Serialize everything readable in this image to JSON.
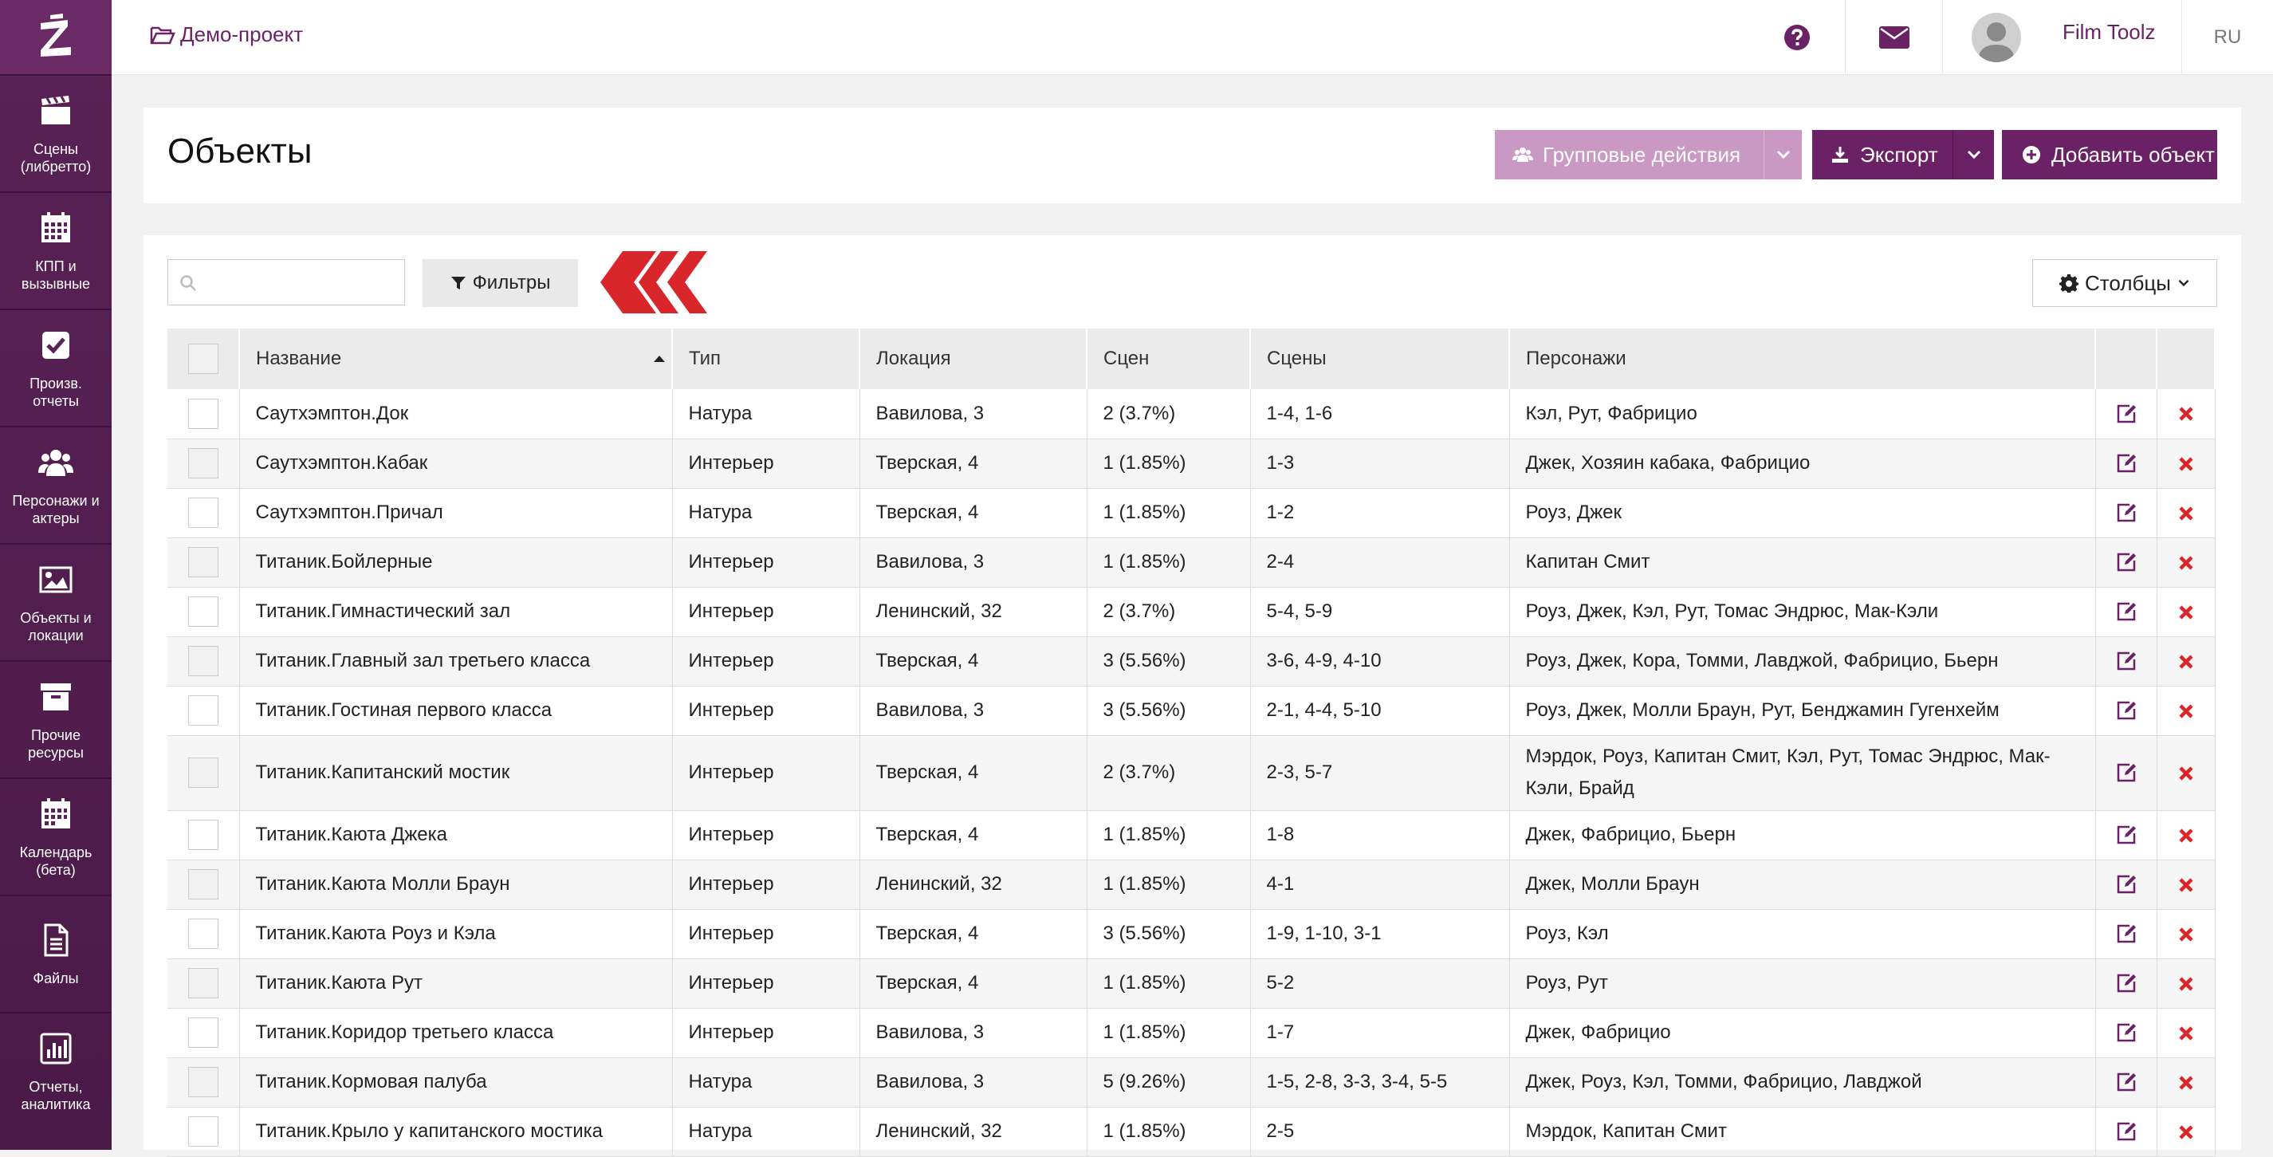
{
  "colors": {
    "sidebar": "#5a2256",
    "accent": "#6a2165",
    "accent_light": "#c998c3",
    "arrow_red": "#d9262a",
    "delete_red": "#d9262a"
  },
  "sidebar": {
    "logo_icon": "z-logo-icon",
    "items": [
      {
        "icon": "clapperboard-icon",
        "label": "Сцены (либретто)"
      },
      {
        "icon": "calendar-grid-icon",
        "label": "КПП и вызывные"
      },
      {
        "icon": "checkbox-icon",
        "label": "Произв. отчеты"
      },
      {
        "icon": "users-icon",
        "label": "Персонажи и актеры"
      },
      {
        "icon": "image-icon",
        "label": "Объекты и локации"
      },
      {
        "icon": "archive-box-icon",
        "label": "Прочие ресурсы"
      },
      {
        "icon": "calendar-icon",
        "label": "Календарь (бета)"
      },
      {
        "icon": "file-icon",
        "label": "Файлы"
      },
      {
        "icon": "bar-chart-icon",
        "label": "Отчеты, аналитика"
      }
    ]
  },
  "topbar": {
    "project": "Демо-проект",
    "user_name": "Film Toolz",
    "language": "RU"
  },
  "header": {
    "title": "Объекты",
    "group_actions_label": "Групповые действия",
    "export_label": "Экспорт",
    "add_label": "Добавить объект"
  },
  "toolbar": {
    "search_placeholder": "",
    "filters_label": "Фильтры",
    "columns_label": "Столбцы"
  },
  "table": {
    "columns": [
      "Название",
      "Тип",
      "Локация",
      "Сцен",
      "Сцены",
      "Персонажи"
    ],
    "rows": [
      [
        "Саутхэмптон.Док",
        "Натура",
        "Вавилова, 3",
        "2 (3.7%)",
        "1-4, 1-6",
        "Кэл, Рут, Фабрицио"
      ],
      [
        "Саутхэмптон.Кабак",
        "Интерьер",
        "Тверская, 4",
        "1 (1.85%)",
        "1-3",
        "Джек, Хозяин кабака, Фабрицио"
      ],
      [
        "Саутхэмптон.Причал",
        "Натура",
        "Тверская, 4",
        "1 (1.85%)",
        "1-2",
        "Роуз, Джек"
      ],
      [
        "Титаник.Бойлерные",
        "Интерьер",
        "Вавилова, 3",
        "1 (1.85%)",
        "2-4",
        "Капитан Смит"
      ],
      [
        "Титаник.Гимнастический зал",
        "Интерьер",
        "Ленинский, 32",
        "2 (3.7%)",
        "5-4, 5-9",
        "Роуз, Джек, Кэл, Рут, Томас Эндрюс, Мак-Кэли"
      ],
      [
        "Титаник.Главный зал третьего класса",
        "Интерьер",
        "Тверская, 4",
        "3 (5.56%)",
        "3-6, 4-9, 4-10",
        "Роуз, Джек, Кора, Томми, Лавджой, Фабрицио, Бьерн"
      ],
      [
        "Титаник.Гостиная первого класса",
        "Интерьер",
        "Вавилова, 3",
        "3 (5.56%)",
        "2-1, 4-4, 5-10",
        "Роуз, Джек, Молли Браун, Рут, Бенджамин Гугенхейм"
      ],
      [
        "Титаник.Капитанский мостик",
        "Интерьер",
        "Тверская, 4",
        "2 (3.7%)",
        "2-3, 5-7",
        "Мэрдок, Роуз, Капитан Смит, Кэл, Рут, Томас Эндрюс, Мак-Кэли, Брайд"
      ],
      [
        "Титаник.Каюта Джека",
        "Интерьер",
        "Тверская, 4",
        "1 (1.85%)",
        "1-8",
        "Джек, Фабрицио, Бьерн"
      ],
      [
        "Титаник.Каюта Молли Браун",
        "Интерьер",
        "Ленинский, 32",
        "1 (1.85%)",
        "4-1",
        "Джек, Молли Браун"
      ],
      [
        "Титаник.Каюта Роуз и Кэла",
        "Интерьер",
        "Тверская, 4",
        "3 (5.56%)",
        "1-9, 1-10, 3-1",
        "Роуз, Кэл"
      ],
      [
        "Титаник.Каюта Рут",
        "Интерьер",
        "Тверская, 4",
        "1 (1.85%)",
        "5-2",
        "Роуз, Рут"
      ],
      [
        "Титаник.Коридор третьего класса",
        "Интерьер",
        "Вавилова, 3",
        "1 (1.85%)",
        "1-7",
        "Джек, Фабрицио"
      ],
      [
        "Титаник.Кормовая палуба",
        "Натура",
        "Вавилова, 3",
        "5 (9.26%)",
        "1-5, 2-8, 3-3, 3-4, 5-5",
        "Джек, Роуз, Кэл, Томми, Фабрицио, Лавджой"
      ],
      [
        "Титаник.Крыло у капитанского мостика",
        "Натура",
        "Ленинский, 32",
        "1 (1.85%)",
        "2-5",
        "Мэрдок, Капитан Смит"
      ]
    ]
  }
}
